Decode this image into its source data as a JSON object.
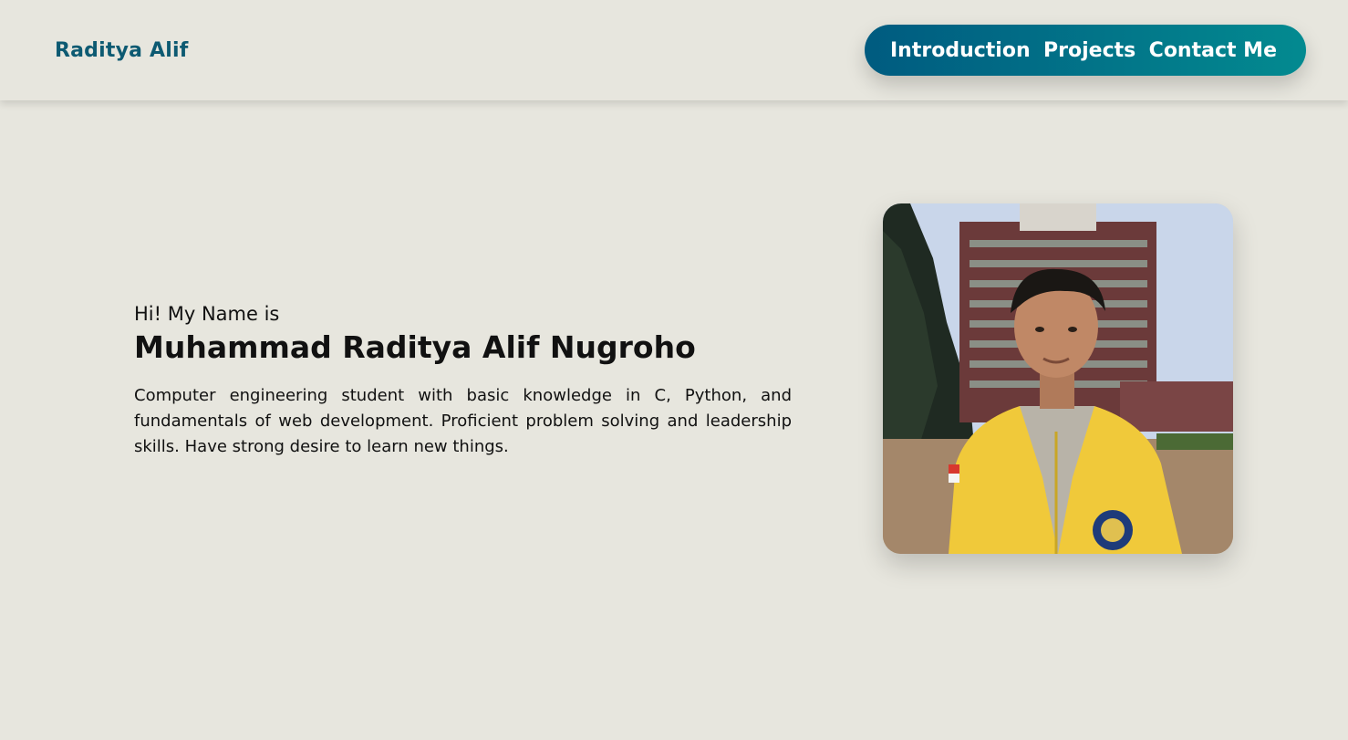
{
  "header": {
    "brand": "Raditya Alif",
    "nav": [
      {
        "label": "Introduction"
      },
      {
        "label": "Projects"
      },
      {
        "label": "Contact Me"
      }
    ]
  },
  "hero": {
    "greeting": "Hi! My Name is",
    "name": "Muhammad Raditya Alif Nugroho",
    "bio": "Computer engineering student with basic knowledge in C, Python, and fundamentals of web development. Proficient problem solving and leadership skills. Have strong desire to learn new things."
  },
  "colors": {
    "background": "#e7e6de",
    "brand": "#0d5a72",
    "nav_gradient_start": "#005b80",
    "nav_gradient_end": "#038a90"
  },
  "photo": {
    "alt": "profile-photo"
  }
}
